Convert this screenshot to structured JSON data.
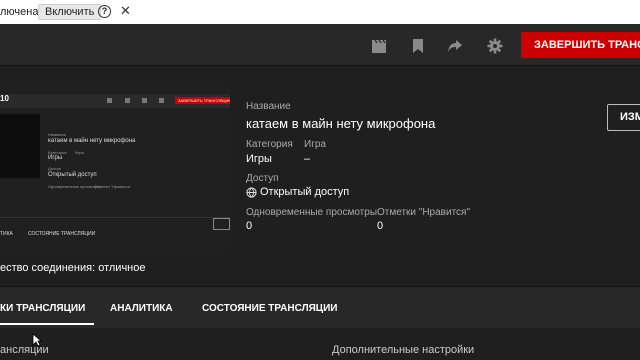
{
  "infobar": {
    "status": "лючена",
    "enable_label": "Включить",
    "help_glyph": "?",
    "close_glyph": "✕"
  },
  "toolbar": {
    "end_stream_label": "ЗАВЕРШИТЬ ТРАНСЛЯ",
    "icons": [
      "clapperboard-icon",
      "bookmark-icon",
      "share-icon",
      "gear-icon"
    ]
  },
  "preview": {
    "counter": "10",
    "mini_end_label": "ЗАВЕРШИТЬ ТРАНСЛЯЦИЮ",
    "mini_title_label": "Название",
    "mini_title": "катаем в майн нету микрофона",
    "mini_category_label": "Категория",
    "mini_category": "Игры",
    "mini_game_label": "Игра",
    "mini_access_label": "Доступ",
    "mini_access": "Открытый доступ",
    "mini_viewers_label": "Одновременные просмотры",
    "mini_likes_label": "Отметки \"Нравится\"",
    "mini_tab1": "ТИКА",
    "mini_tab2": "СОСТОЯНИЕ ТРАНСЛЯЦИИ"
  },
  "info": {
    "title_label": "Название",
    "title": "катаем в майн нету микрофона",
    "category_label": "Категория",
    "category": "Игры",
    "game_label": "Игра",
    "game": "–",
    "access_label": "Доступ",
    "access": "Открытый доступ",
    "viewers_label": "Одновременные просмотры",
    "viewers": "0",
    "likes_label": "Отметки \"Нравится\"",
    "likes": "0",
    "edit_label": "ИЗМ"
  },
  "quality": "ество соединения: отличное",
  "tabs": [
    "КИ ТРАНСЛЯЦИИ",
    "АНАЛИТИКА",
    "СОСТОЯНИЕ ТРАНСЛЯЦИИ"
  ],
  "sections": {
    "left": "ансляции",
    "right": "Дополнительные настройки"
  },
  "colors": {
    "accent_red": "#cc0000",
    "background": "#1f1f1f",
    "bar": "#282828"
  }
}
